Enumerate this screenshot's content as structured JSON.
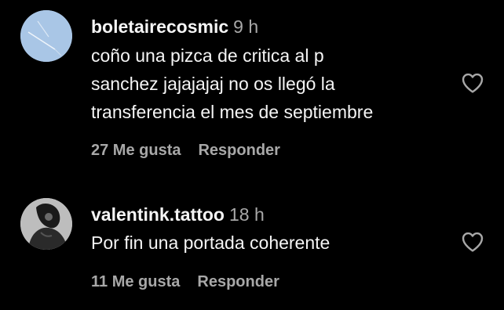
{
  "comments": [
    {
      "username": "boletairecosmic",
      "time": "9 h",
      "lines": [
        "coño una pizca de critica al p",
        "sanchez jajajajaj no os llegó la",
        "transferencia el mes de septiembre"
      ],
      "likes": "27 Me gusta",
      "reply": "Responder",
      "avatar_color": "#a9c6e6",
      "icon": "heart-outline-icon"
    },
    {
      "username": "valentink.tattoo",
      "time": "18 h",
      "lines": [
        "Por fin una portada coherente"
      ],
      "likes": "11 Me gusta",
      "reply": "Responder",
      "avatar_color": "#3a3a3a",
      "icon": "heart-outline-icon"
    }
  ],
  "colors": {
    "background": "#000000",
    "primary_text": "#f5f5f5",
    "secondary_text": "#a8a8a8"
  }
}
